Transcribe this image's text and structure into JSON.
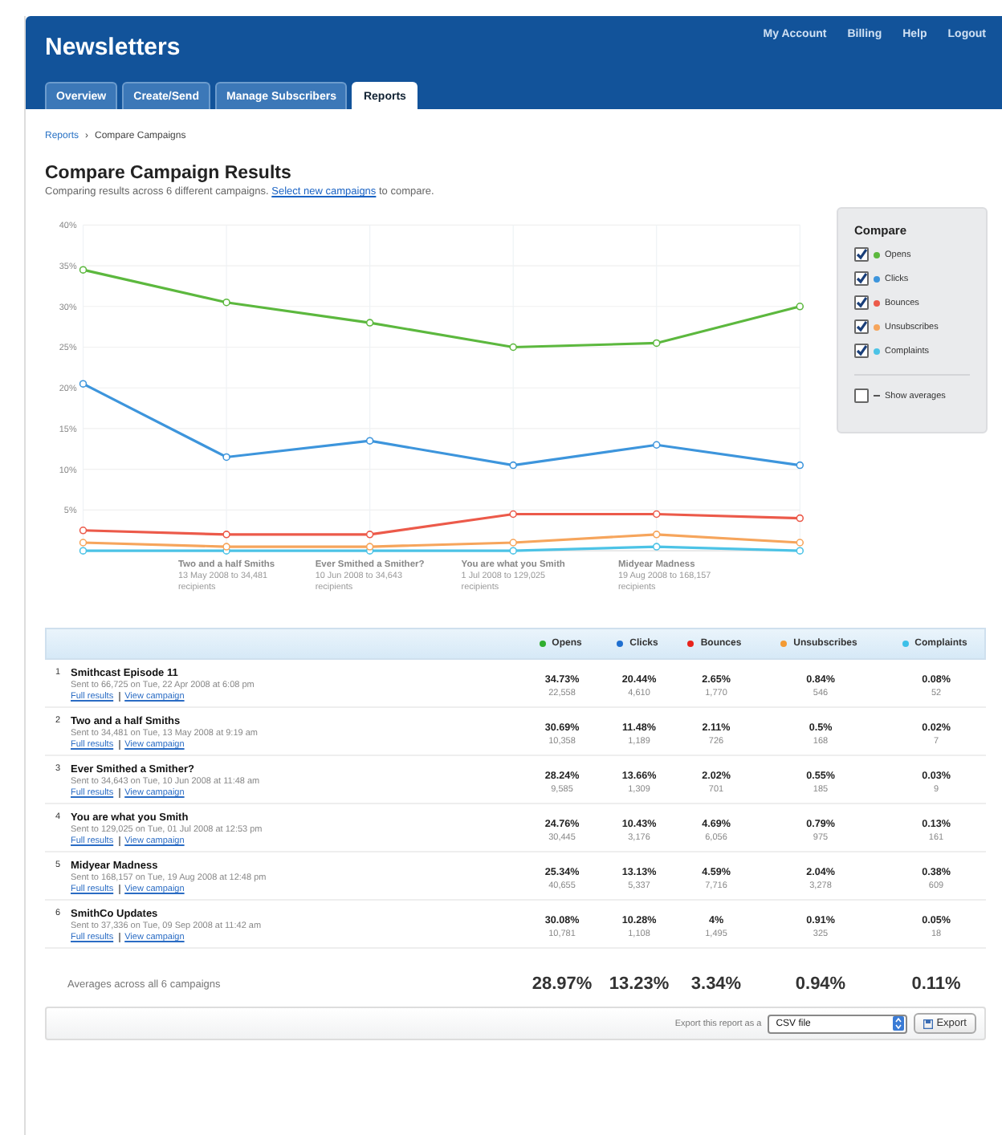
{
  "header": {
    "title": "Newsletters",
    "account_links": [
      "My Account",
      "Billing",
      "Help",
      "Logout"
    ],
    "tabs": [
      {
        "label": "Overview",
        "selected": false
      },
      {
        "label": "Create/Send",
        "selected": false
      },
      {
        "label": "Manage Subscribers",
        "selected": false
      },
      {
        "label": "Reports",
        "selected": true
      }
    ]
  },
  "breadcrumb": {
    "link": "Reports",
    "separator": "›",
    "current": "Compare Campaigns"
  },
  "page": {
    "title": "Compare Campaign Results",
    "intro_before": "Comparing results across 6 different campaigns.",
    "intro_link": "Select new campaigns",
    "intro_after": "to compare."
  },
  "chart": {
    "chart_data": {
      "type": "line",
      "categories": [
        null,
        "Two and a half Smiths",
        "Ever Smithed a Smither?",
        "You are what you Smith",
        "Midyear Madness",
        null
      ],
      "grid": true,
      "ylim": [
        0,
        40
      ],
      "yticks": [
        {
          "value": 5,
          "label": "5%"
        },
        {
          "value": 10,
          "label": "10%"
        },
        {
          "value": 15,
          "label": "15%"
        },
        {
          "value": 20,
          "label": "20%"
        },
        {
          "value": 25,
          "label": "25%"
        },
        {
          "value": 30,
          "label": "30%"
        },
        {
          "value": 35,
          "label": "35%"
        },
        {
          "value": 40,
          "label": "40%"
        }
      ],
      "series": [
        {
          "name": "Opens",
          "color": "#5cb83e",
          "marker": "circle",
          "values": [
            34.5,
            30.5,
            28,
            25,
            25.5,
            30
          ]
        },
        {
          "name": "Clicks",
          "color": "#3d95dc",
          "marker": "circle",
          "values": [
            20.5,
            11.5,
            13.5,
            10.5,
            13,
            10.5
          ]
        },
        {
          "name": "Bounces",
          "color": "#ec5a4a",
          "marker": "circle",
          "values": [
            2.5,
            2,
            2,
            4.5,
            4.5,
            4
          ]
        },
        {
          "name": "Unsubscribes",
          "color": "#f6a55c",
          "marker": "circle",
          "values": [
            1,
            0.5,
            0.5,
            1,
            2,
            1
          ]
        },
        {
          "name": "Complaints",
          "color": "#4cc3e6",
          "marker": "circle",
          "values": [
            0,
            0,
            0,
            0,
            0.5,
            0
          ]
        }
      ]
    },
    "category_details": [
      {
        "detail": "13 May 2008 to 34,481",
        "unit": "recipients"
      },
      {
        "detail": "10 Jun 2008 to 34,643",
        "unit": "recipients"
      },
      {
        "detail": "1 Jul 2008 to 129,025",
        "unit": "recipients"
      },
      {
        "detail": "19 Aug 2008 to 168,157",
        "unit": "recipients"
      }
    ]
  },
  "compare": {
    "title": "Compare",
    "items": [
      {
        "checked": true
      },
      {
        "checked": true
      },
      {
        "checked": true
      },
      {
        "checked": true
      },
      {
        "checked": true
      }
    ],
    "averages": {
      "label": "Show averages",
      "checked": false
    }
  },
  "table": {
    "columns": [
      {
        "label": "Opens",
        "color": "#2fae2f"
      },
      {
        "label": "Clicks",
        "color": "#1f6fd0"
      },
      {
        "label": "Bounces",
        "color": "#e8231b"
      },
      {
        "label": "Unsubscribes",
        "color": "#f39a33"
      },
      {
        "label": "Complaints",
        "color": "#3cc0e8"
      }
    ],
    "rows": [
      {
        "number": "1",
        "name": "Smithcast Episode 11",
        "sent": "Sent to 66,725 on Tue, 22 Apr 2008 at 6:08 pm",
        "links": [
          "Full results",
          "View campaign"
        ],
        "metrics": [
          {
            "rate": "34.73%",
            "count": "22,558"
          },
          {
            "rate": "20.44%",
            "count": "4,610"
          },
          {
            "rate": "2.65%",
            "count": "1,770"
          },
          {
            "rate": "0.84%",
            "count": "546"
          },
          {
            "rate": "0.08%",
            "count": "52"
          }
        ]
      },
      {
        "number": "2",
        "name": "Two and a half Smiths",
        "sent": "Sent to 34,481 on Tue, 13 May 2008 at 9:19 am",
        "links": [
          "Full results",
          "View campaign"
        ],
        "metrics": [
          {
            "rate": "30.69%",
            "count": "10,358"
          },
          {
            "rate": "11.48%",
            "count": "1,189"
          },
          {
            "rate": "2.11%",
            "count": "726"
          },
          {
            "rate": "0.5%",
            "count": "168"
          },
          {
            "rate": "0.02%",
            "count": "7"
          }
        ]
      },
      {
        "number": "3",
        "name": "Ever Smithed a Smither?",
        "sent": "Sent to 34,643 on Tue, 10 Jun 2008 at 11:48 am",
        "links": [
          "Full results",
          "View campaign"
        ],
        "metrics": [
          {
            "rate": "28.24%",
            "count": "9,585"
          },
          {
            "rate": "13.66%",
            "count": "1,309"
          },
          {
            "rate": "2.02%",
            "count": "701"
          },
          {
            "rate": "0.55%",
            "count": "185"
          },
          {
            "rate": "0.03%",
            "count": "9"
          }
        ]
      },
      {
        "number": "4",
        "name": "You are what you Smith",
        "sent": "Sent to 129,025 on Tue, 01 Jul 2008 at 12:53 pm",
        "links": [
          "Full results",
          "View campaign"
        ],
        "metrics": [
          {
            "rate": "24.76%",
            "count": "30,445"
          },
          {
            "rate": "10.43%",
            "count": "3,176"
          },
          {
            "rate": "4.69%",
            "count": "6,056"
          },
          {
            "rate": "0.79%",
            "count": "975"
          },
          {
            "rate": "0.13%",
            "count": "161"
          }
        ]
      },
      {
        "number": "5",
        "name": "Midyear Madness",
        "sent": "Sent to 168,157 on Tue, 19 Aug 2008 at 12:48 pm",
        "links": [
          "Full results",
          "View campaign"
        ],
        "metrics": [
          {
            "rate": "25.34%",
            "count": "40,655"
          },
          {
            "rate": "13.13%",
            "count": "5,337"
          },
          {
            "rate": "4.59%",
            "count": "7,716"
          },
          {
            "rate": "2.04%",
            "count": "3,278"
          },
          {
            "rate": "0.38%",
            "count": "609"
          }
        ]
      },
      {
        "number": "6",
        "name": "SmithCo Updates",
        "sent": "Sent to 37,336 on Tue, 09 Sep 2008 at 11:42 am",
        "links": [
          "Full results",
          "View campaign"
        ],
        "metrics": [
          {
            "rate": "30.08%",
            "count": "10,781"
          },
          {
            "rate": "10.28%",
            "count": "1,108"
          },
          {
            "rate": "4%",
            "count": "1,495"
          },
          {
            "rate": "0.91%",
            "count": "325"
          },
          {
            "rate": "0.05%",
            "count": "18"
          }
        ]
      }
    ],
    "averages": {
      "label": "Averages across all 6 campaigns",
      "values": [
        "28.97%",
        "13.23%",
        "3.34%",
        "0.94%",
        "0.11%"
      ]
    }
  },
  "export": {
    "label": "Export this report as a",
    "format": "CSV file",
    "button": "Export"
  }
}
